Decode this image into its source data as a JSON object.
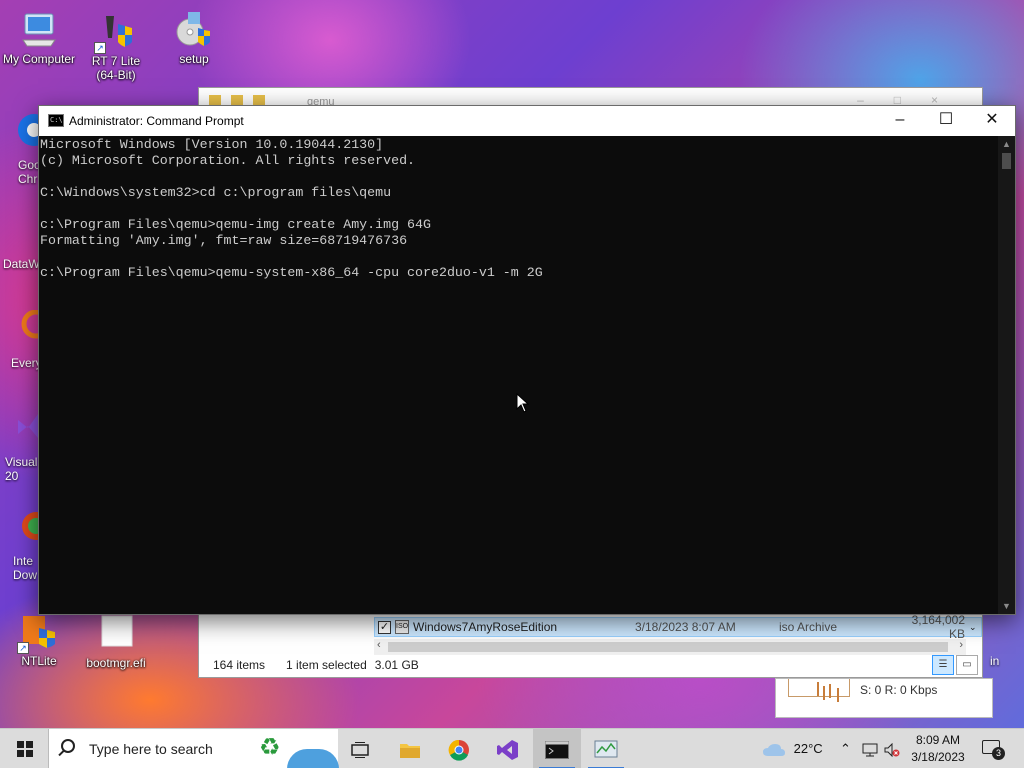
{
  "desktop": {
    "icons": [
      {
        "label": "My Computer"
      },
      {
        "label": "RT 7 Lite\n(64-Bit)"
      },
      {
        "label": "setup"
      },
      {
        "label": "NTLite"
      },
      {
        "label": "bootmgr.efi"
      }
    ],
    "partial_labels": [
      "Goo\nChr",
      "DataW",
      "Every",
      "Visual\n20",
      "Inte\nDow"
    ]
  },
  "explorer": {
    "title": "qemu",
    "file": {
      "name": "Windows7AmyRoseEdition",
      "date": "3/18/2023 8:07 AM",
      "type": "iso Archive",
      "size": "3,164,002 KB"
    },
    "status": {
      "items": "164 items",
      "selected": "1 item selected",
      "size": "3.01 GB"
    }
  },
  "netpanel": {
    "text": "S: 0  R: 0 Kbps",
    "side": "in"
  },
  "cmd": {
    "title": "Administrator: Command Prompt",
    "lines": [
      "Microsoft Windows [Version 10.0.19044.2130]",
      "(c) Microsoft Corporation. All rights reserved.",
      "",
      "C:\\Windows\\system32>cd c:\\program files\\qemu",
      "",
      "c:\\Program Files\\qemu>qemu-img create Amy.img 64G",
      "Formatting 'Amy.img', fmt=raw size=68719476736",
      "",
      "c:\\Program Files\\qemu>qemu-system-x86_64 -cpu core2duo-v1 -m 2G"
    ]
  },
  "taskbar": {
    "search_placeholder": "Type here to search",
    "weather": "22°C",
    "time": "8:09 AM",
    "date": "3/18/2023",
    "notification_count": "3"
  }
}
